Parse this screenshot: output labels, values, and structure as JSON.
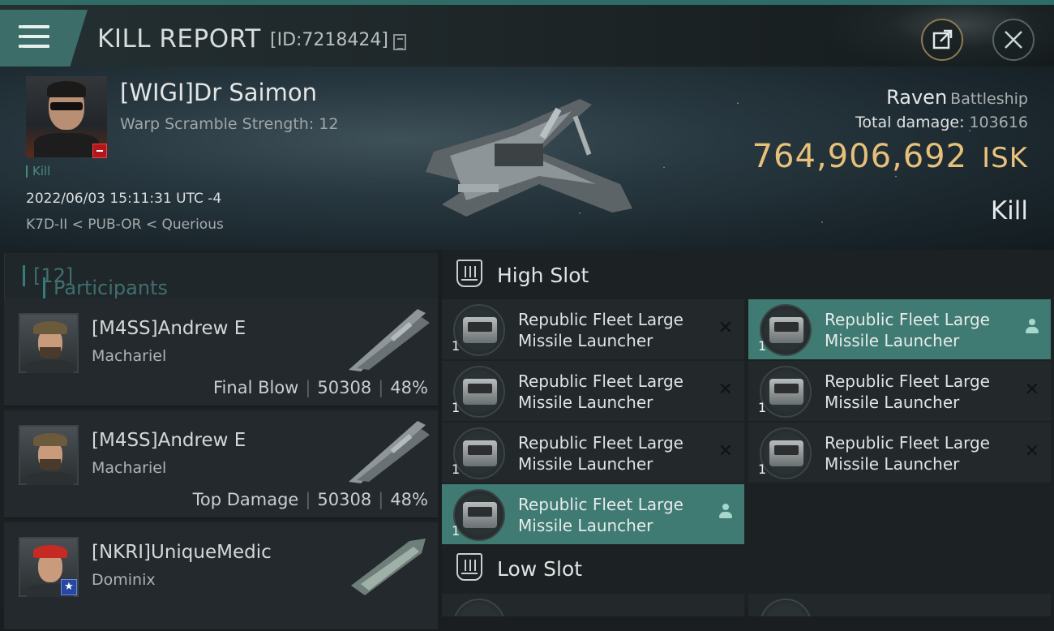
{
  "header": {
    "title": "KILL REPORT",
    "report_id": "[ID:7218424]"
  },
  "victim": {
    "name": "[WIGI]Dr Saimon",
    "warp_scramble": "Warp Scramble Strength: 12",
    "tag": "Kill",
    "time": "2022/06/03 15:11:31 UTC -4",
    "location": "K7D-II < PUB-OR < Querious",
    "ship_name": "Raven",
    "ship_class": "Battleship",
    "total_damage_label": "Total damage:",
    "total_damage": "103616",
    "isk_value": "764,906,692",
    "isk_unit": "ISK",
    "result": "Kill"
  },
  "participants": {
    "label": "Participants",
    "count": "[12]",
    "rows": [
      {
        "name": "[M4SS]Andrew E",
        "ship": "Machariel",
        "role": "Final Blow",
        "damage": "50308",
        "percent": "48%"
      },
      {
        "name": "[M4SS]Andrew E",
        "ship": "Machariel",
        "role": "Top Damage",
        "damage": "50308",
        "percent": "48%"
      },
      {
        "name": "[NKRI]UniqueMedic",
        "ship": "Dominix",
        "role": "",
        "damage": "",
        "percent": ""
      }
    ]
  },
  "high_slot": {
    "title": "High Slot",
    "modules": [
      {
        "line1": "Republic Fleet Large",
        "line2": "Missile Launcher",
        "qty": "1",
        "state": "destroyed"
      },
      {
        "line1": "Republic Fleet Large",
        "line2": "Missile Launcher",
        "qty": "1",
        "state": "dropped"
      },
      {
        "line1": "Republic Fleet Large",
        "line2": "Missile Launcher",
        "qty": "1",
        "state": "destroyed"
      },
      {
        "line1": "Republic Fleet Large",
        "line2": "Missile Launcher",
        "qty": "1",
        "state": "destroyed"
      },
      {
        "line1": "Republic Fleet Large",
        "line2": "Missile Launcher",
        "qty": "1",
        "state": "destroyed"
      },
      {
        "line1": "Republic Fleet Large",
        "line2": "Missile Launcher",
        "qty": "1",
        "state": "destroyed"
      },
      {
        "line1": "Republic Fleet Large",
        "line2": "Missile Launcher",
        "qty": "1",
        "state": "dropped"
      }
    ]
  },
  "low_slot": {
    "title": "Low Slot"
  },
  "colors": {
    "accent_teal": "#3f7a73",
    "isk_gold": "#e7c07a",
    "badge_red": "#b3161d"
  },
  "icons": [
    "menu-icon",
    "copy-icon",
    "share-icon",
    "close-icon",
    "slot-icon",
    "destroyed-x-icon",
    "dropped-person-icon"
  ]
}
